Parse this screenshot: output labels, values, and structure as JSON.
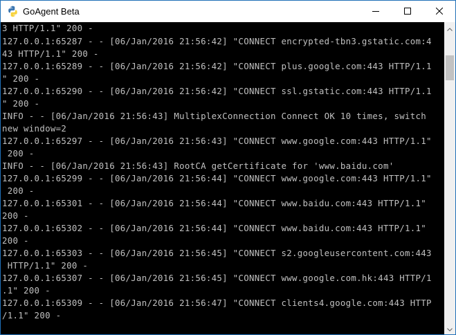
{
  "window": {
    "title": "GoAgent Beta",
    "icon": "python-icon",
    "controls": {
      "minimize": "minimize-icon",
      "maximize": "maximize-icon",
      "close": "close-icon"
    }
  },
  "console": {
    "lines": [
      "3 HTTP/1.1\" 200 -",
      "127.0.0.1:65287 - - [06/Jan/2016 21:56:42] \"CONNECT encrypted-tbn3.gstatic.com:4",
      "43 HTTP/1.1\" 200 -",
      "127.0.0.1:65289 - - [06/Jan/2016 21:56:42] \"CONNECT plus.google.com:443 HTTP/1.1",
      "\" 200 -",
      "127.0.0.1:65290 - - [06/Jan/2016 21:56:42] \"CONNECT ssl.gstatic.com:443 HTTP/1.1",
      "\" 200 -",
      "INFO - - [06/Jan/2016 21:56:43] MultiplexConnection Connect OK 10 times, switch",
      "new window=2",
      "127.0.0.1:65297 - - [06/Jan/2016 21:56:43] \"CONNECT www.google.com:443 HTTP/1.1\"",
      " 200 -",
      "INFO - - [06/Jan/2016 21:56:43] RootCA getCertificate for 'www.baidu.com'",
      "127.0.0.1:65299 - - [06/Jan/2016 21:56:44] \"CONNECT www.google.com:443 HTTP/1.1\"",
      " 200 -",
      "127.0.0.1:65301 - - [06/Jan/2016 21:56:44] \"CONNECT www.baidu.com:443 HTTP/1.1\"",
      "200 -",
      "127.0.0.1:65302 - - [06/Jan/2016 21:56:44] \"CONNECT www.baidu.com:443 HTTP/1.1\"",
      "200 -",
      "127.0.0.1:65303 - - [06/Jan/2016 21:56:45] \"CONNECT s2.googleusercontent.com:443",
      " HTTP/1.1\" 200 -",
      "127.0.0.1:65307 - - [06/Jan/2016 21:56:45] \"CONNECT www.google.com.hk:443 HTTP/1",
      ".1\" 200 -",
      "127.0.0.1:65309 - - [06/Jan/2016 21:56:47] \"CONNECT clients4.google.com:443 HTTP",
      "/1.1\" 200 -"
    ]
  },
  "scrollbar": {
    "up_icon": "scroll-up-arrow-icon",
    "down_icon": "scroll-down-arrow-icon"
  },
  "colors": {
    "console_background": "#000000",
    "console_text": "#c0c0c0",
    "titlebar": "#ffffff",
    "window_border": "#1f6fb8"
  }
}
